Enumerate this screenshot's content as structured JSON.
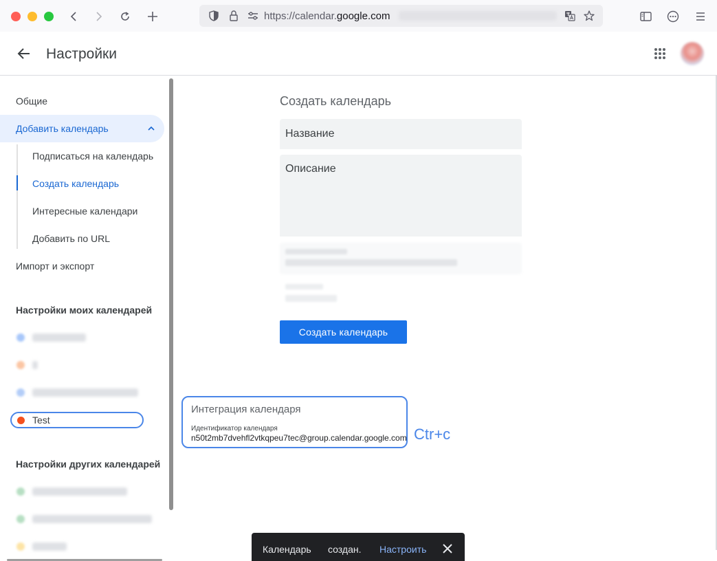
{
  "browser": {
    "url_prefix": "https://calendar.",
    "url_domain": "google.com",
    "icons": [
      "back-icon",
      "forward-icon",
      "reload-icon",
      "new-tab-icon",
      "shield-icon",
      "lock-icon",
      "site-settings-icon",
      "translate-icon",
      "star-icon",
      "sidebar-icon",
      "extensions-icon",
      "menu-icon"
    ]
  },
  "header": {
    "title": "Настройки"
  },
  "sidebar": {
    "general": "Общие",
    "add_calendar": "Добавить календарь",
    "subscribe": "Подписаться на календарь",
    "create": "Создать календарь",
    "interesting": "Интересные календари",
    "add_url": "Добавить по URL",
    "import_export": "Импорт и экспорт",
    "my_settings_title": "Настройки моих календарей",
    "test_calendar": "Test",
    "other_settings_title": "Настройки других календарей"
  },
  "main": {
    "title": "Создать календарь",
    "name_placeholder": "Название",
    "description_placeholder": "Описание",
    "create_button": "Создать календарь"
  },
  "integration": {
    "title": "Интеграция календаря",
    "id_label": "Идентификатор календаря",
    "id_value": "n50t2mb7dvehfl2vtkqpeu7tec@group.calendar.google.com",
    "hint": "Ctr+c"
  },
  "snackbar": {
    "text_part1": "Календарь",
    "text_part2": "создан.",
    "action": "Настроить"
  },
  "colors": {
    "accent": "#1a73e8",
    "active_bg": "#e8f0fe",
    "highlight": "#4a86e8",
    "test_dot": "#f4511e"
  }
}
